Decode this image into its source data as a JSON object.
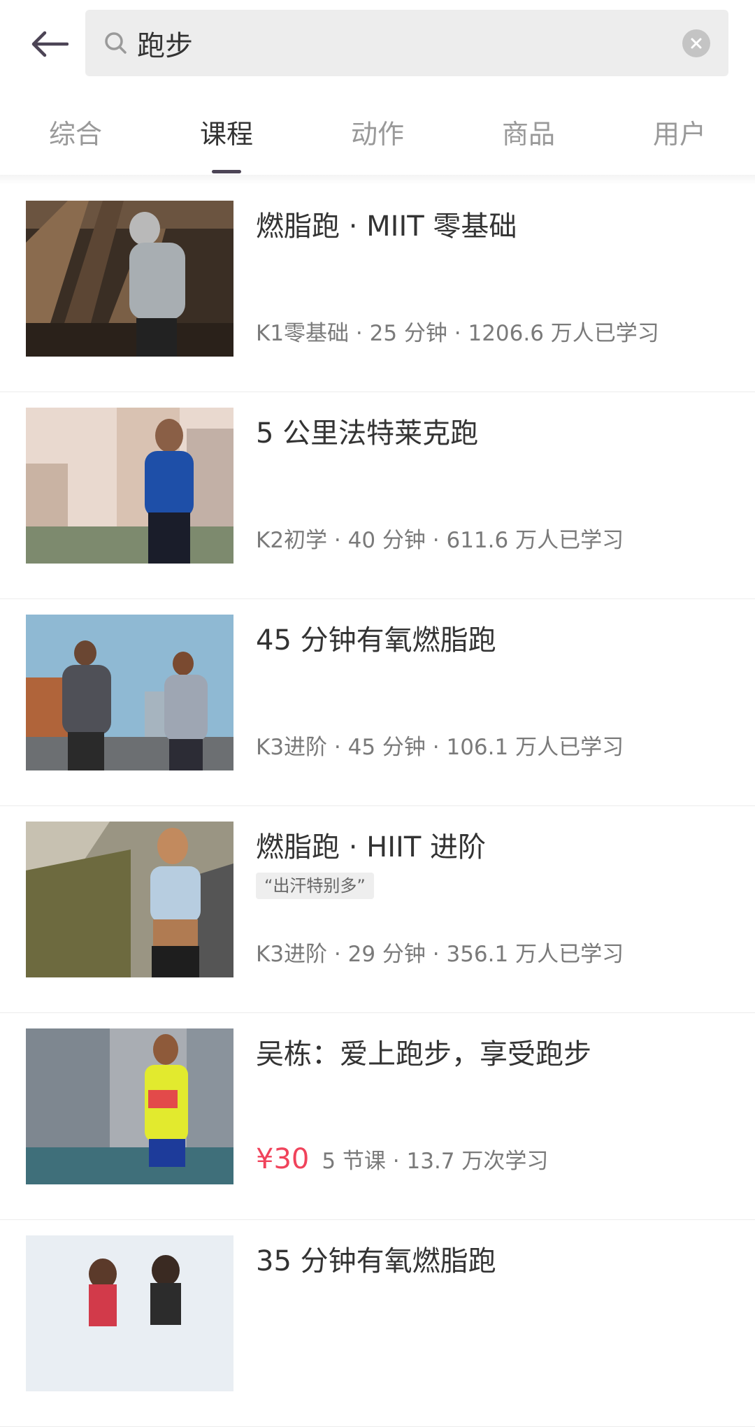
{
  "search": {
    "query": "跑步"
  },
  "tabs": [
    {
      "label": "综合",
      "active": false
    },
    {
      "label": "课程",
      "active": true
    },
    {
      "label": "动作",
      "active": false
    },
    {
      "label": "商品",
      "active": false
    },
    {
      "label": "用户",
      "active": false
    }
  ],
  "courses": [
    {
      "title": "燃脂跑 · MIIT 零基础",
      "meta": "K1零基础 · 25 分钟 ·  1206.6 万人已学习"
    },
    {
      "title": "5 公里法特莱克跑",
      "meta": "K2初学 · 40 分钟 ·  611.6 万人已学习"
    },
    {
      "title": "45 分钟有氧燃脂跑",
      "meta": "K3进阶 · 45 分钟 ·  106.1 万人已学习"
    },
    {
      "title": "燃脂跑 · HIIT 进阶",
      "tag": "“出汗特别多”",
      "meta": "K3进阶 · 29 分钟 ·  356.1 万人已学习"
    },
    {
      "title": "吴栋：爱上跑步，享受跑步",
      "price": "¥30",
      "meta": "5 节课 · 13.7 万次学习"
    },
    {
      "title": "35 分钟有氧燃脂跑"
    }
  ],
  "colors": {
    "accent": "#4c4455",
    "price": "#f0435b"
  }
}
